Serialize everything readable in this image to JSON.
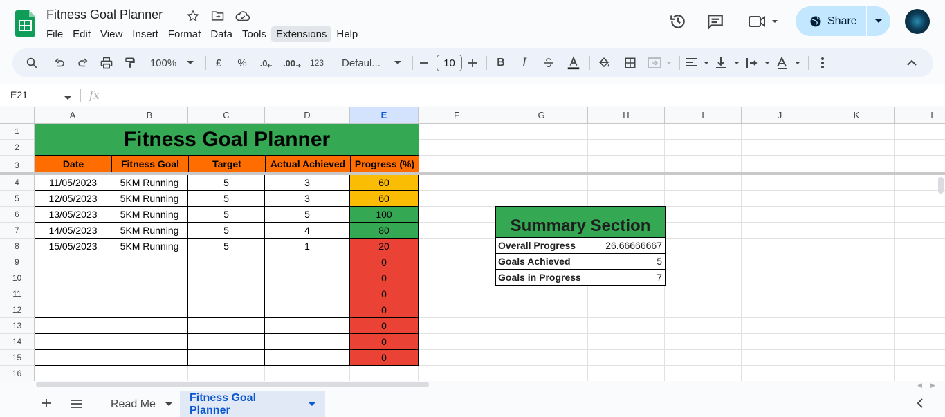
{
  "doc": {
    "title": "Fitness Goal Planner"
  },
  "menu": [
    "File",
    "Edit",
    "View",
    "Insert",
    "Format",
    "Data",
    "Tools",
    "Extensions",
    "Help"
  ],
  "share_label": "Share",
  "toolbar": {
    "zoom": "100%",
    "currency": "£",
    "percent": "%",
    "dec_less": ".0",
    "dec_more": ".00",
    "number_format": "123",
    "font": "Defaul...",
    "font_size": "10"
  },
  "formula_bar": {
    "cell_ref": "E21",
    "fx": "fx",
    "value": ""
  },
  "columns": [
    "A",
    "B",
    "C",
    "D",
    "E",
    "F",
    "G",
    "H",
    "I",
    "J",
    "K",
    "L"
  ],
  "rows": [
    "1",
    "2",
    "3",
    "4",
    "5",
    "6",
    "7",
    "8",
    "9",
    "10",
    "11",
    "12",
    "13",
    "14",
    "15",
    "16"
  ],
  "sheet": {
    "title": "Fitness Goal Planner",
    "headers": [
      "Date",
      "Fitness Goal",
      "Target",
      "Actual Achieved",
      "Progress (%)"
    ],
    "data": [
      [
        "11/05/2023",
        "5KM Running",
        "5",
        "3",
        "60"
      ],
      [
        "12/05/2023",
        "5KM Running",
        "5",
        "3",
        "60"
      ],
      [
        "13/05/2023",
        "5KM Running",
        "5",
        "5",
        "100"
      ],
      [
        "14/05/2023",
        "5KM Running",
        "5",
        "4",
        "80"
      ],
      [
        "15/05/2023",
        "5KM Running",
        "5",
        "1",
        "20"
      ],
      [
        "",
        "",
        "",
        "",
        "0"
      ],
      [
        "",
        "",
        "",
        "",
        "0"
      ],
      [
        "",
        "",
        "",
        "",
        "0"
      ],
      [
        "",
        "",
        "",
        "",
        "0"
      ],
      [
        "",
        "",
        "",
        "",
        "0"
      ],
      [
        "",
        "",
        "",
        "",
        "0"
      ],
      [
        "",
        "",
        "",
        "",
        "0"
      ]
    ],
    "progress_colors": {
      "60": "#fbbc04",
      "100": "#34a853",
      "80": "#34a853",
      "20": "#ea4335",
      "0": "#ea4335"
    }
  },
  "summary": {
    "title": "Summary Section",
    "items": [
      {
        "label": "Overall Progress",
        "value": "26.66666667"
      },
      {
        "label": "Goals Achieved",
        "value": "5"
      },
      {
        "label": "Goals in Progress",
        "value": "7"
      }
    ]
  },
  "tabs": [
    {
      "label": "Read Me",
      "active": false
    },
    {
      "label": "Fitness Goal Planner",
      "active": true
    }
  ],
  "colors": {
    "green": "#34a853",
    "orange": "#ff6d01",
    "share_bg": "#c2e7ff",
    "accent": "#0b57d0"
  }
}
